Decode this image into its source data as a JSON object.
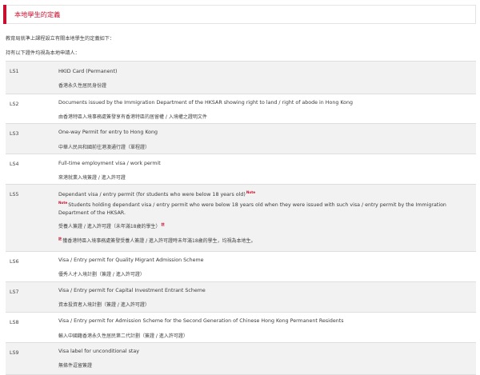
{
  "title": "本地學生的定義",
  "intro_line1": "教育局就準上課程設立有關本地學生的定義如下：",
  "intro_line2": "持有以下證件均視為本地申請人：",
  "rows": [
    {
      "code": "LS1",
      "en": "HKID Card (Permanent)",
      "zh": "香港永久性居民身份證"
    },
    {
      "code": "LS2",
      "en": "Documents issued by the Immigration Department of the HKSAR showing right to land / right of abode in Hong Kong",
      "zh": "由香港特區入境事務處簽發享有香港特區的居留權 / 入境權之證明文件"
    },
    {
      "code": "LS3",
      "en": "One-way Permit for entry to Hong Kong",
      "zh": "中華人民共和國前往港澳通行證（單程證）"
    },
    {
      "code": "LS4",
      "en": "Full-time employment visa / work permit",
      "zh": "來港就業入境簽證 / 進入許可證"
    },
    {
      "code": "LS5",
      "en": "Dependant visa / entry permit (for students who were below 18 years old)",
      "en_note": "Note",
      "note_label": "Note",
      "note_text": "Students holding dependant visa / entry permit who were below 18 years old when they were issued with such visa / entry permit by the Immigration Department of the HKSAR.",
      "zh": "受養人簽證 / 進入許可證（未年滿18歲的學生）",
      "zh_note": "註",
      "zh_note_label": "註",
      "zh_note_text": "獲香港特區入境事務處簽發受養人簽證 / 進入許可證時未年滿18歲的學生，均視為本地生。"
    },
    {
      "code": "LS6",
      "en": "Visa / Entry permit for Quality Migrant Admission Scheme",
      "zh": "優秀人才入境計劃（簽證 / 進入許可證）"
    },
    {
      "code": "LS7",
      "en": "Visa / Entry permit for Capital Investment Entrant Scheme",
      "zh": "資本投資者入境計劃（簽證 / 進入許可證）"
    },
    {
      "code": "LS8",
      "en": "Visa / Entry permit for Admission Scheme for the Second Generation of Chinese Hong Kong Permanent Residents",
      "zh": "輸入中國籍香港永久性居民第二代計劃（簽證 / 進入許可證）"
    },
    {
      "code": "LS9",
      "en": "Visa label for unconditional stay",
      "zh": "無條件逗留簽證"
    }
  ]
}
